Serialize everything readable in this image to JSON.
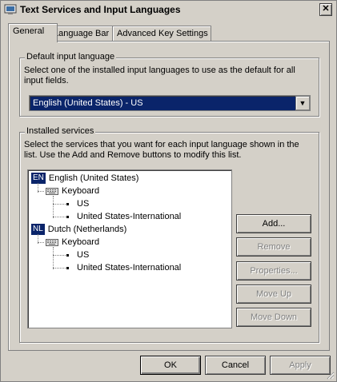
{
  "window": {
    "title": "Text Services and Input Languages",
    "close_glyph": "✕"
  },
  "tabs": [
    {
      "label": "General",
      "active": true
    },
    {
      "label": "Language Bar",
      "active": false
    },
    {
      "label": "Advanced Key Settings",
      "active": false
    }
  ],
  "default_input": {
    "group_label": "Default input language",
    "description": "Select one of the installed input languages to use as the default for all input fields.",
    "selected": "English (United States) - US"
  },
  "installed_services": {
    "group_label": "Installed services",
    "description": "Select the services that you want for each input language shown in the list. Use the Add and Remove buttons to modify this list.",
    "tree": [
      {
        "badge": "EN",
        "language": "English (United States)",
        "category": "Keyboard",
        "items": [
          "US",
          "United States-International"
        ]
      },
      {
        "badge": "NL",
        "language": "Dutch (Netherlands)",
        "category": "Keyboard",
        "items": [
          "US",
          "United States-International"
        ]
      }
    ],
    "buttons": {
      "add": "Add...",
      "remove": "Remove",
      "properties": "Properties...",
      "move_up": "Move Up",
      "move_down": "Move Down"
    }
  },
  "footer": {
    "ok": "OK",
    "cancel": "Cancel",
    "apply": "Apply"
  }
}
